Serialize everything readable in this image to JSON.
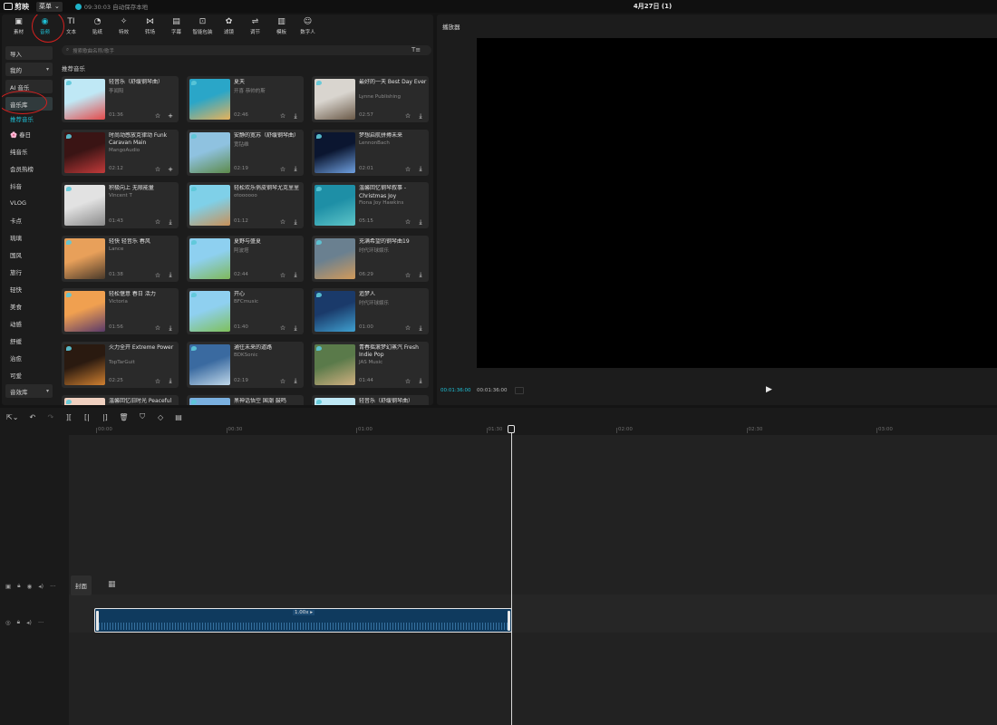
{
  "app": {
    "name": "剪映",
    "menu_label": "菜单",
    "autosave_text": "09:30:03 自动保存本地",
    "project_title": "4月27日 (1)"
  },
  "toolbar": [
    {
      "label": "素材",
      "icon": "▣"
    },
    {
      "label": "音频",
      "icon": "◉"
    },
    {
      "label": "文本",
      "icon": "TI"
    },
    {
      "label": "贴纸",
      "icon": "◔"
    },
    {
      "label": "特效",
      "icon": "✧"
    },
    {
      "label": "转场",
      "icon": "⋈"
    },
    {
      "label": "字幕",
      "icon": "▤"
    },
    {
      "label": "智能包装",
      "icon": "⊡"
    },
    {
      "label": "滤镜",
      "icon": "✿"
    },
    {
      "label": "调节",
      "icon": "⇌"
    },
    {
      "label": "模板",
      "icon": "▥"
    },
    {
      "label": "数字人",
      "icon": "☺"
    }
  ],
  "categories": {
    "import": "导入",
    "mine": "我的",
    "ai_music": "AI 音乐",
    "music_library": "音乐库",
    "recommended": "推荐音乐",
    "items": [
      "🌸 春日",
      "纯音乐",
      "会员热榜",
      "抖音",
      "VLOG",
      "卡点",
      "琉璃",
      "国风",
      "旅行",
      "轻快",
      "美食",
      "动感",
      "舒缓",
      "治愈",
      "可爱"
    ],
    "sound_effects": "音效库"
  },
  "search": {
    "placeholder": "搜索歌曲名称/歌手",
    "filter_icon": "T≡"
  },
  "section_title": "推荐音乐",
  "songs": [
    {
      "title": "轻音乐（舒缓钢琴曲）",
      "artist": "李闻阳",
      "duration": "01:36",
      "action": "+",
      "c1": "#bfe8f5",
      "c2": "#e34a4a"
    },
    {
      "title": "夏天",
      "artist": "开喜 恭帅的斯",
      "duration": "02:46",
      "action": "⤓",
      "c1": "#2aa6c8",
      "c2": "#e7b25a"
    },
    {
      "title": "最好的一天  Best Day Ever",
      "artist": "Lynne Publishing",
      "duration": "02:57",
      "action": "⤓",
      "c1": "#d9d5cf",
      "c2": "#6b5a48"
    },
    {
      "title": "时尚动感放克律动  Funk Caravan Main",
      "artist": "MangoAudio",
      "duration": "02:12",
      "action": "+",
      "c1": "#3a1414",
      "c2": "#c23a3a"
    },
    {
      "title": "安静的宽苏（舒缓钢琴曲）",
      "artist": "宽钻维",
      "duration": "02:19",
      "action": "⤓",
      "c1": "#8fc2e0",
      "c2": "#5d8a4a"
    },
    {
      "title": "梦想启航拼搏未来",
      "artist": "LennonBach",
      "duration": "02:01",
      "action": "⤓",
      "c1": "#0b1630",
      "c2": "#6fa0e0"
    },
    {
      "title": "积极向上 无限能量",
      "artist": "Vincent T",
      "duration": "01:43",
      "action": "⤓",
      "c1": "#e2e2e2",
      "c2": "#8a8a8a"
    },
    {
      "title": "轻松欢乐俏皮钢琴尤克里里",
      "artist": "otoooooo",
      "duration": "01:12",
      "action": "⤓",
      "c1": "#7fd0e8",
      "c2": "#c99058"
    },
    {
      "title": "温馨回忆钢琴叙事 - Christmas Joy",
      "artist": "Fiona Joy Hawkins",
      "duration": "05:15",
      "action": "⤓",
      "c1": "#1e8fa6",
      "c2": "#5ec5c8"
    },
    {
      "title": "轻快 轻音乐 春风",
      "artist": "Lance",
      "duration": "01:38",
      "action": "⤓",
      "c1": "#e8a05a",
      "c2": "#4a3a2a"
    },
    {
      "title": "夏野与盛夏",
      "artist": "阿波塔",
      "duration": "02:44",
      "action": "⤓",
      "c1": "#8ed0f0",
      "c2": "#7fb85a"
    },
    {
      "title": "充满希望的钢琴曲19",
      "artist": "时代环球娱乐",
      "duration": "06:29",
      "action": "⤓",
      "c1": "#6a8090",
      "c2": "#d29a5a"
    },
    {
      "title": "轻松惬意 春日 活力",
      "artist": "Victoria",
      "duration": "01:56",
      "action": "⤓",
      "c1": "#f0a050",
      "c2": "#5a3a6a"
    },
    {
      "title": "开心",
      "artist": "BFCmusic",
      "duration": "01:40",
      "action": "⤓",
      "c1": "#8fd0f0",
      "c2": "#7fc05a"
    },
    {
      "title": "追梦人",
      "artist": "时代环球娱乐",
      "duration": "01:00",
      "action": "⤓",
      "c1": "#1a3a6a",
      "c2": "#3fa0d0"
    },
    {
      "title": "火力全开  Extreme Power",
      "artist": "TopTarGuit",
      "duration": "02:25",
      "action": "⤓",
      "c1": "#2a1a10",
      "c2": "#d08030"
    },
    {
      "title": "通往未来的道路",
      "artist": "BDKSonic",
      "duration": "02:19",
      "action": "⤓",
      "c1": "#3a6aa0",
      "c2": "#c0d8ea"
    },
    {
      "title": "青春摇滚梦幻蒸汽 Fresh Indie Pop",
      "artist": "JAS Music",
      "duration": "01:44",
      "action": "⤓",
      "c1": "#5a7a4a",
      "c2": "#d0b080"
    },
    {
      "title": "温馨回忆旧时光  Peaceful Piano Relaxation Mo",
      "artist": "",
      "duration": "",
      "action": "",
      "c1": "#f0d0c0",
      "c2": "#a05a4a"
    },
    {
      "title": "黑神话悟空 国潮 鼓鸣",
      "artist": "",
      "duration": "",
      "action": "",
      "c1": "#7ab0e0",
      "c2": "#e0e8f0"
    },
    {
      "title": "轻音乐（舒缓钢琴曲）",
      "artist": "李闻阳",
      "duration": "",
      "action": "",
      "c1": "#bfe8f5",
      "c2": "#e34a4a"
    }
  ],
  "player": {
    "title": "播放器",
    "current_time": "00:01:36:00",
    "total_time": "00:01:36:00",
    "play_icon": "▶"
  },
  "timeline": {
    "ruler": [
      "00:00",
      "00:30",
      "01:00",
      "01:30",
      "02:00",
      "02:30",
      "03:00"
    ],
    "cover_label": "封面",
    "speed_label": "1.00x ▸"
  },
  "colors": {
    "accent": "#1fc0d6",
    "annotation_ring": "#d3201f",
    "audio_clip": "#0f3a5e"
  }
}
